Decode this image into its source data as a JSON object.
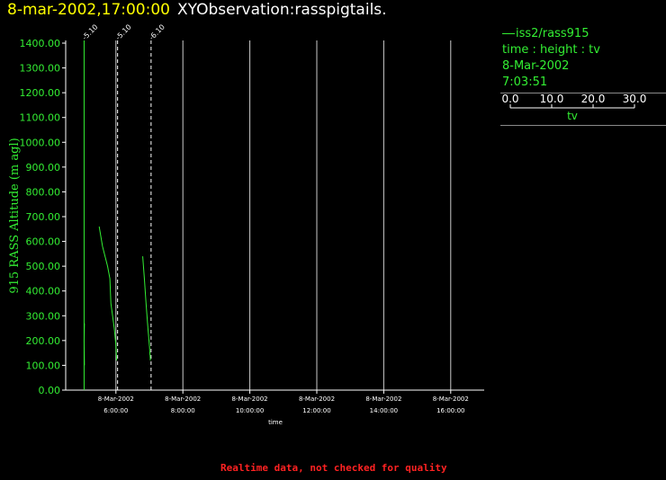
{
  "header": {
    "date": "8-mar-2002,17:00:00",
    "title": "XYObservation:rasspigtails."
  },
  "legend": {
    "series_name": "iss2/rass915",
    "line1": "time : height : tv",
    "line2": "8-Mar-2002",
    "line3": "7:03:51",
    "scale_ticks": [
      "0.0",
      "10.0",
      "20.0",
      "30.0"
    ],
    "scale_label": "tv"
  },
  "footer": "Realtime data, not checked for quality",
  "colors": {
    "background": "#000000",
    "axis": "#ffffff",
    "grid": "#cccccc",
    "data": "#33ee33",
    "date_text": "#ffff00",
    "footer_text": "#ff2222"
  },
  "chart_data": {
    "type": "line",
    "xlabel": "time",
    "ylabel": "915 RASS Altitude (m agl)",
    "ylim": [
      0,
      1400
    ],
    "y_ticks": [
      0,
      100,
      200,
      300,
      400,
      500,
      600,
      700,
      800,
      900,
      1000,
      1100,
      1200,
      1300,
      1400
    ],
    "y_tick_labels": [
      "0.00",
      "100.00",
      "200.00",
      "300.00",
      "400.00",
      "500.00",
      "600.00",
      "700.00",
      "800.00",
      "900.00",
      "1000.00",
      "1100.00",
      "1200.00",
      "1300.00",
      "1400.00"
    ],
    "xlim_hours": [
      4.5,
      17.0
    ],
    "x_ticks": [
      {
        "hour": 6,
        "date": "8-Mar-2002",
        "time": "6:00:00"
      },
      {
        "hour": 8,
        "date": "8-Mar-2002",
        "time": "8:00:00"
      },
      {
        "hour": 10,
        "date": "8-Mar-2002",
        "time": "10:00:00"
      },
      {
        "hour": 12,
        "date": "8-Mar-2002",
        "time": "12:00:00"
      },
      {
        "hour": 14,
        "date": "8-Mar-2002",
        "time": "14:00:00"
      },
      {
        "hour": 16,
        "date": "8-Mar-2002",
        "time": "16:00:00"
      }
    ],
    "grid": true,
    "profiles": [
      {
        "hour": 5.05,
        "label": "-5.10",
        "points": [
          [
            5.06,
            100
          ],
          [
            5.05,
            200
          ],
          [
            5.06,
            270
          ]
        ]
      },
      {
        "hour": 6.05,
        "label": "-5.10",
        "points": [
          [
            5.5,
            660
          ],
          [
            5.6,
            580
          ],
          [
            5.75,
            500
          ],
          [
            5.82,
            450
          ],
          [
            5.85,
            350
          ],
          [
            5.95,
            250
          ],
          [
            6.0,
            180
          ],
          [
            6.02,
            120
          ]
        ]
      },
      {
        "hour": 7.05,
        "label": "-6.10",
        "points": [
          [
            6.8,
            540
          ],
          [
            6.85,
            450
          ],
          [
            6.9,
            350
          ],
          [
            6.95,
            260
          ],
          [
            7.0,
            180
          ],
          [
            7.03,
            120
          ]
        ]
      }
    ]
  }
}
